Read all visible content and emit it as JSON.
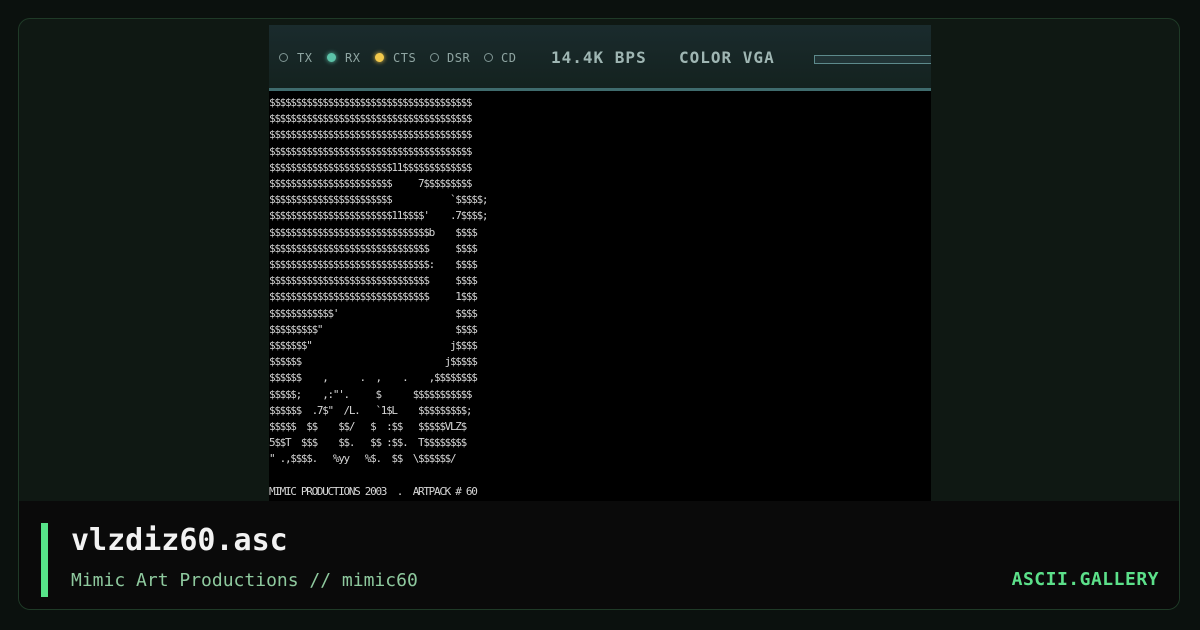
{
  "status_bar": {
    "indicators": [
      {
        "label": "TX",
        "active": false
      },
      {
        "label": "RX",
        "active": true,
        "color": "#5cc2a8"
      },
      {
        "label": "CTS",
        "active": true,
        "color": "#f2c94c"
      },
      {
        "label": "DSR",
        "active": false
      },
      {
        "label": "CD",
        "active": false
      }
    ],
    "speed": "14.4K BPS",
    "mode": "COLOR VGA"
  },
  "art": {
    "lines": [
      "$$$$$$$$$$$$$$$$$$$$$$$$$$$$$$$$$$$$$$",
      "$$$$$$$$$$$$$$$$$$$$$$$$$$$$$$$$$$$$$$",
      "$$$$$$$$$$$$$$$$$$$$$$$$$$$$$$$$$$$$$$",
      "$$$$$$$$$$$$$$$$$$$$$$$$$$$$$$$$$$$$$$",
      "$$$$$$$$$$$$$$$$$$$$$$$11$$$$$$$$$$$$$",
      "$$$$$$$$$$$$$$$$$$$$$$$     7$$$$$$$$$",
      "$$$$$$$$$$$$$$$$$$$$$$$           `$$$$$;",
      "$$$$$$$$$$$$$$$$$$$$$$$11$$$$'    .7$$$$;",
      "$$$$$$$$$$$$$$$$$$$$$$$$$$$$$$b    $$$$",
      "$$$$$$$$$$$$$$$$$$$$$$$$$$$$$$     $$$$",
      "$$$$$$$$$$$$$$$$$$$$$$$$$$$$$$:    $$$$",
      "$$$$$$$$$$$$$$$$$$$$$$$$$$$$$$     $$$$",
      "$$$$$$$$$$$$$$$$$$$$$$$$$$$$$$     1$$$",
      "$$$$$$$$$$$$'                      $$$$",
      "$$$$$$$$$\"                         $$$$",
      "$$$$$$$\"                          j$$$$",
      "$$$$$$                           j$$$$$",
      "$$$$$$    ,      .  ,    .    ,$$$$$$$$",
      "$$$$$;    ,:\"'.     $      $$$$$$$$$$$",
      "$$$$$$  .7$\"  /L.   `1$L    $$$$$$$$$;",
      "$$$$$  $$    $$/   $  :$$   $$$$$VLZ$",
      "5$$T  $$$    $$.   $$ :$$.  T$$$$$$$$",
      "\" .,$$$$.   %yy   %$.  $$  \\$$$$$$/",
      "",
      "MIMIC PRODUCTIONS 2003  .  ARTPACK # 60"
    ]
  },
  "caption": {
    "title": "vlzdiz60.asc",
    "subtitle": "Mimic Art Productions // mimic60",
    "brand": "ASCII.GALLERY"
  }
}
